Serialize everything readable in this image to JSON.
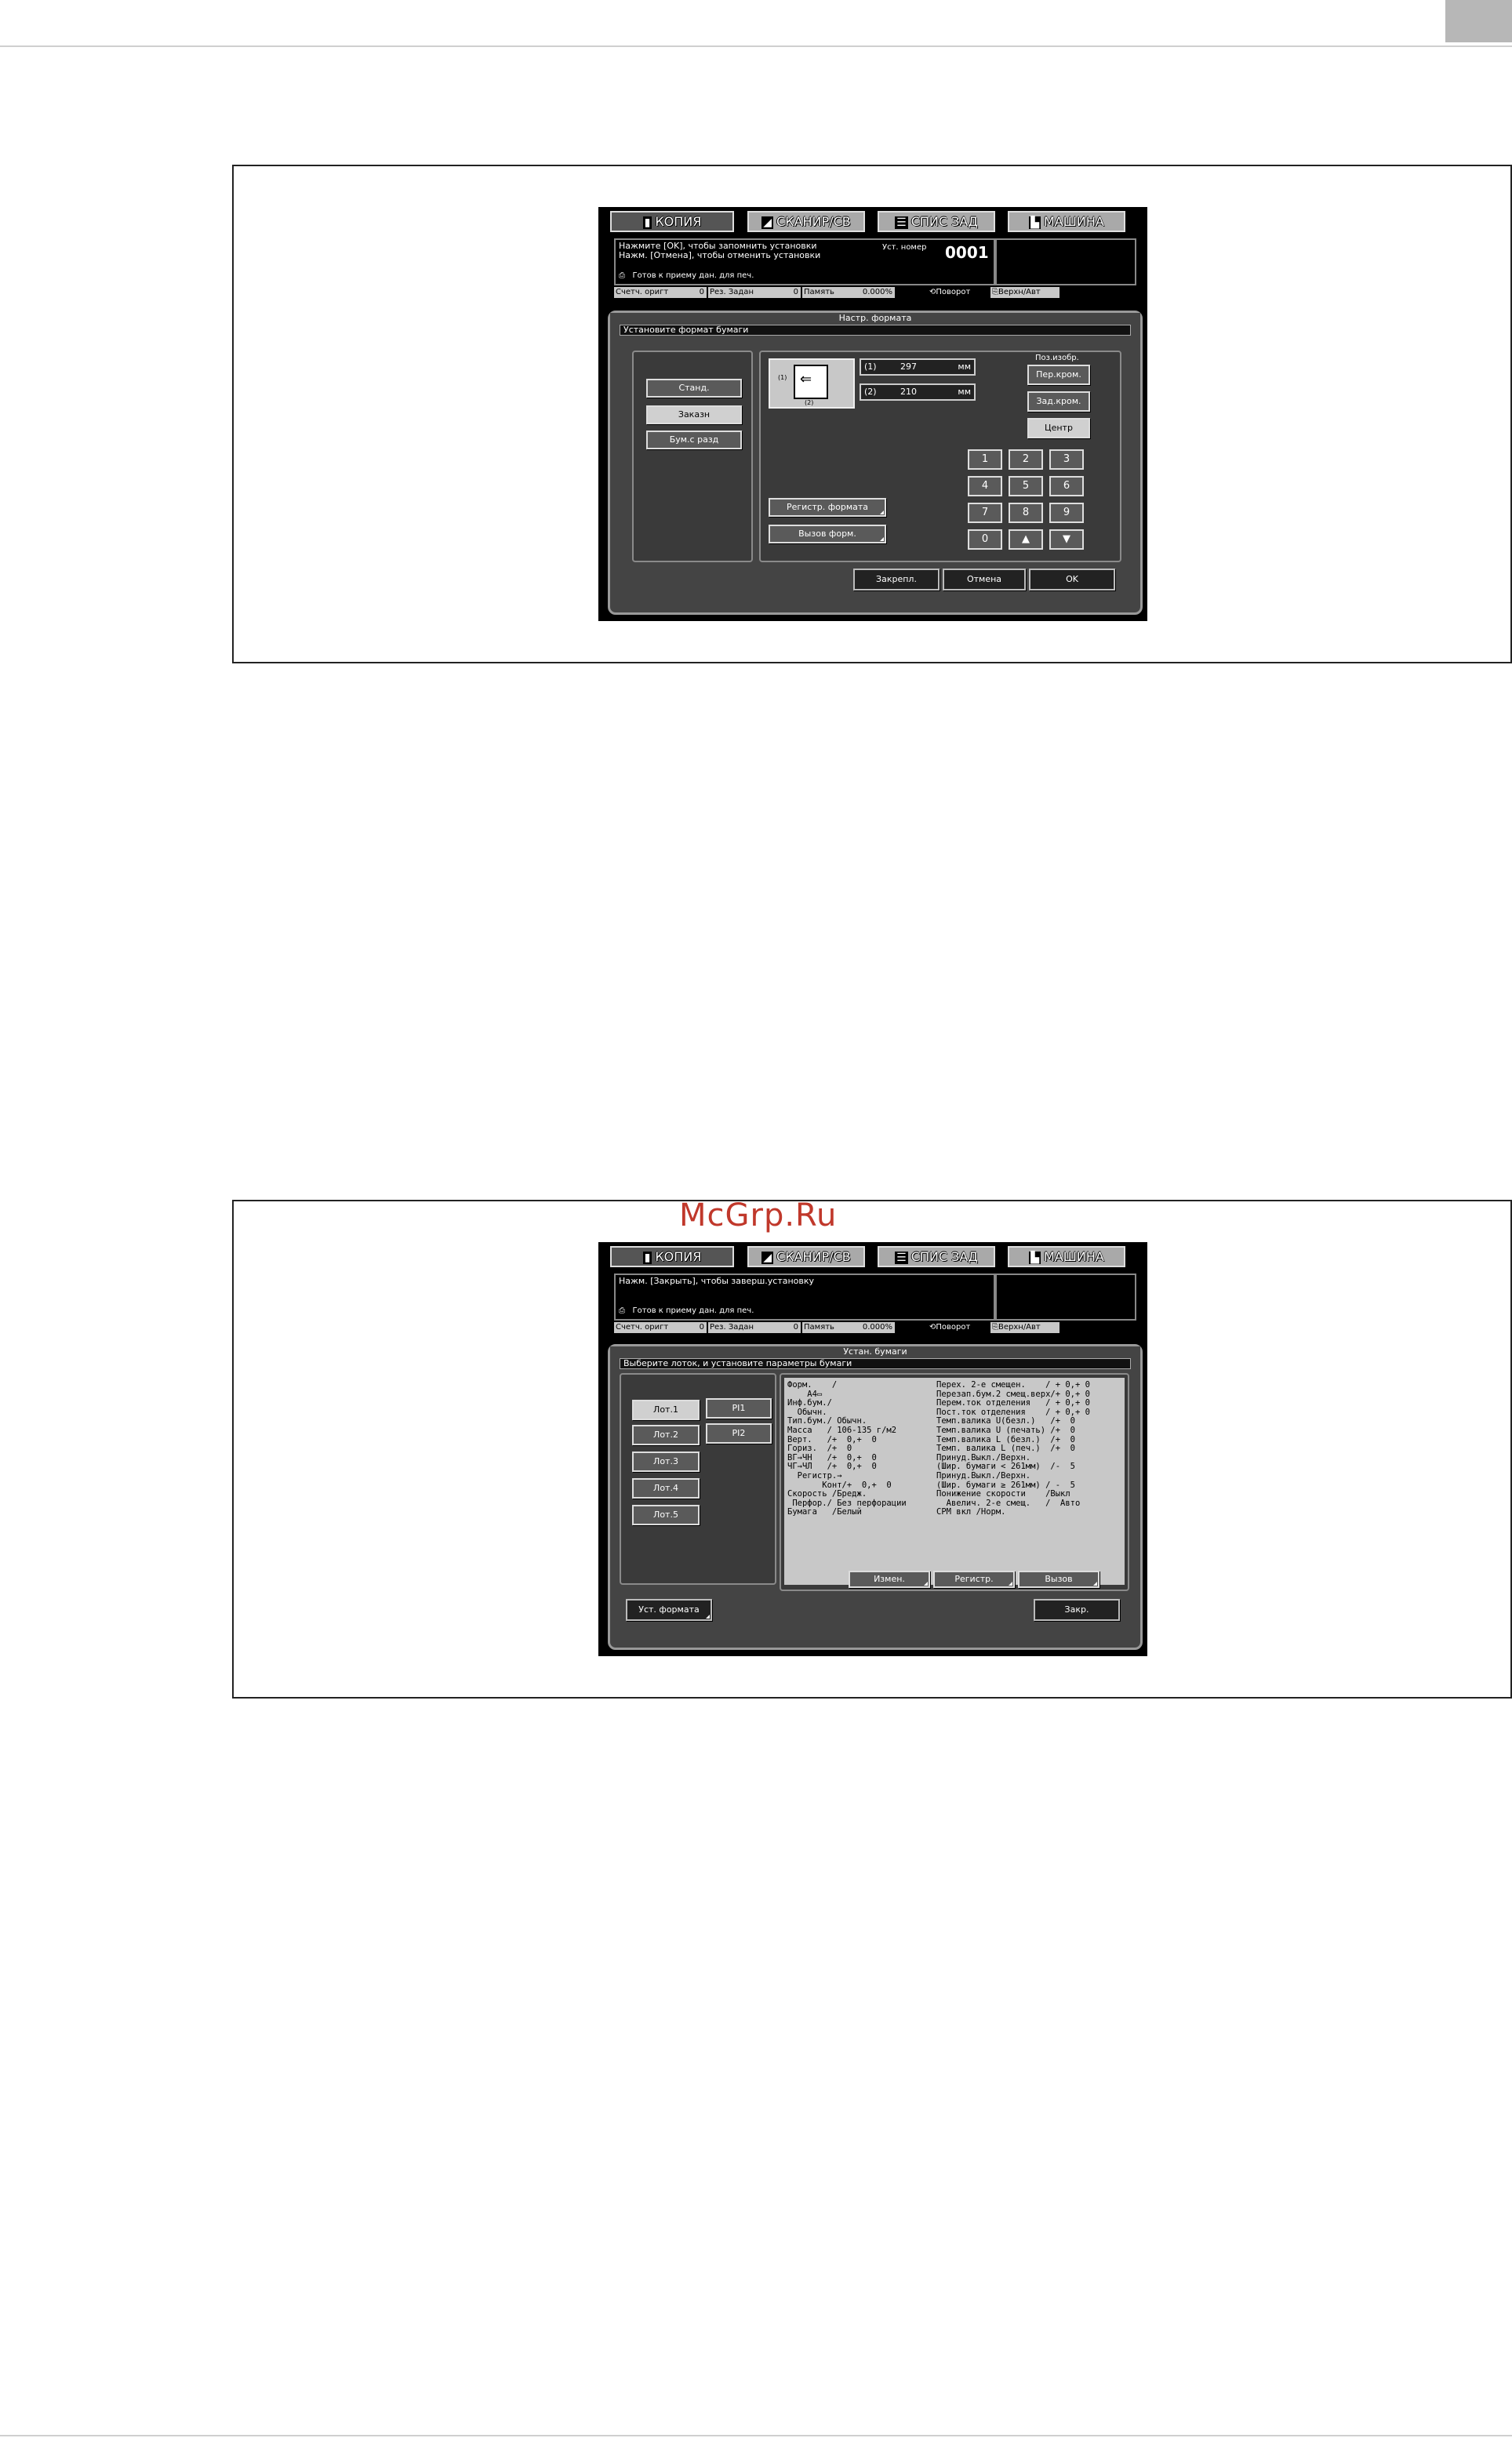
{
  "watermark": "McGrp.Ru",
  "tabs": [
    {
      "icon": "copy-icon",
      "label": "КОПИЯ"
    },
    {
      "icon": "scanner-icon",
      "label": "СКАНИР/СВ"
    },
    {
      "icon": "job-list-icon",
      "label": "СПИС ЗАД"
    },
    {
      "icon": "machine-icon",
      "label": "МАШИНА"
    }
  ],
  "screen1": {
    "message_line1": "Нажмите [OK], чтобы запомнить установки",
    "message_line2": "Нажм. [Отмена], чтобы отменить установки",
    "status": "Готов к приему дан. для печ.",
    "set_number_label": "Уст. номер",
    "set_number": "0001",
    "counters": {
      "orig_label": "Счетч. оригт",
      "orig_value": "0",
      "res_label": "Рез. Задан",
      "res_value": "0",
      "memory_label": "Память",
      "memory_value": "0.000%",
      "rotate_label": "Поворот",
      "sleep_label": "Верхн/Авт"
    },
    "dialog_title": "Настр. формата",
    "instruction": "Установите формат бумаги",
    "type_buttons": [
      "Станд.",
      "Заказн",
      "Бум.с разд"
    ],
    "selected_type": "Заказн",
    "diagram_labels": {
      "dim1": "(1)",
      "dim2": "(2)"
    },
    "field1_label": "(1)",
    "field1_value": "297",
    "field1_unit": "мм",
    "field2_label": "(2)",
    "field2_value": "210",
    "field2_unit": "мм",
    "position_label": "Поз.изобр.",
    "position_buttons": [
      "Пер.кром.",
      "Зад.кром.",
      "Центр"
    ],
    "selected_position": "Центр",
    "keypad": [
      "1",
      "2",
      "3",
      "4",
      "5",
      "6",
      "7",
      "8",
      "9",
      "0",
      "▲",
      "▼"
    ],
    "register_button": "Регистр. формата",
    "recall_button": "Вызов форм.",
    "footer_buttons": [
      "Закрепл.",
      "Отмена",
      "OK"
    ]
  },
  "screen2": {
    "message_line1": "Нажм. [Закрыть], чтобы заверш.установку",
    "status": "Готов к приему дан. для печ.",
    "counters": {
      "orig_label": "Счетч. оригт",
      "orig_value": "0",
      "res_label": "Рез. Задан",
      "res_value": "0",
      "memory_label": "Память",
      "memory_value": "0.000%",
      "rotate_label": "Поворот",
      "sleep_label": "Верхн/Авт"
    },
    "dialog_title": "Устан. бумаги",
    "instruction": "Выберите лоток, и установите параметры бумаги",
    "trays": [
      "Лот.1",
      "Лот.2",
      "Лот.3",
      "Лот.4",
      "Лот.5"
    ],
    "pi_trays": [
      "PI1",
      "PI2"
    ],
    "selected_tray": "Лот.1",
    "info_left": [
      "Форм.    /",
      "    A4▭",
      "Инф.бум./",
      "  Обычн.",
      "Тип.бум./ Обычн.",
      "Масса   / 106-135 г/м2",
      "Верт.   /+  0,+  0",
      "Гориз.  /+  0",
      "ВГ→ЧН   /+  0,+  0",
      "ЧГ→ЧЛ   /+  0,+  0",
      "  Регистр.→",
      "       Конт/+  0,+  0",
      "Скорость /Бредж.",
      " Перфор./ Без перфорации",
      "Бумага   /Белый"
    ],
    "info_right": [
      "Перех. 2-е смещен.    / + 0,+ 0",
      "Перезап.бум.2 смещ.верх/+ 0,+ 0",
      "Перем.ток отделения   / + 0,+ 0",
      "Пост.ток отделения    / + 0,+ 0",
      "Темп.валика U(безл.)   /+  0",
      "Темп.валика U (печать) /+  0",
      "Темп.валика L (безл.)  /+  0",
      "Темп. валика L (печ.)  /+  0",
      "Принуд.Выкл./Верхн.",
      "(Шир. бумаги < 261мм)  /-  5",
      "Принуд.Выкл./Верхн.",
      "(Шир. бумаги ≥ 261мм) / -  5",
      "Понижение скорости    /Выкл",
      "  Авелич. 2-е смещ.   /  Авто",
      "СРМ вкл /Норм."
    ],
    "info_buttons": [
      "Измен.",
      "Регистр.",
      "Вызов"
    ],
    "format_button": "Уст. формата",
    "close_button": "Закр."
  }
}
